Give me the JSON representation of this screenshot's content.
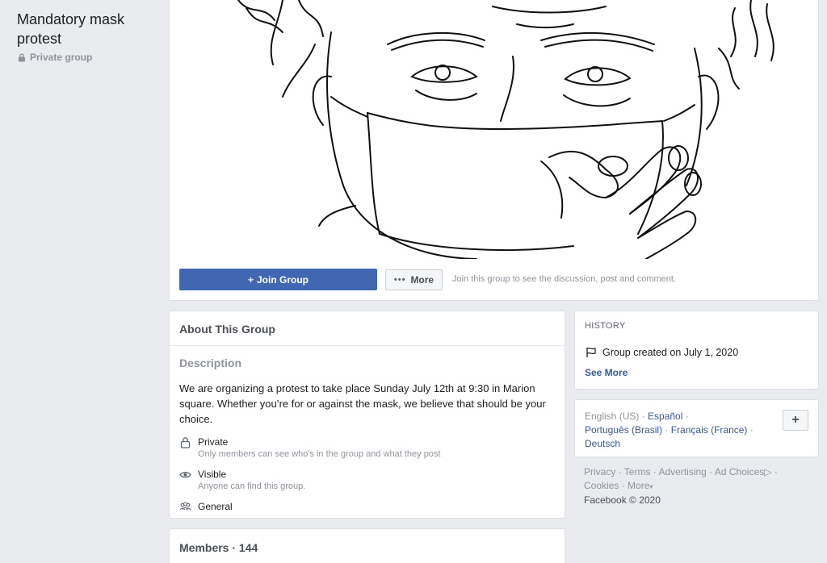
{
  "group": {
    "name": "Mandatory mask protest",
    "privacy": "Private group"
  },
  "actions": {
    "join_label": "Join Group",
    "more_label": "More",
    "hint": "Join this group to see the discussion, post and comment."
  },
  "about": {
    "title": "About This Group",
    "description_label": "Description",
    "description": "We are organizing a protest to take place Sunday July 12th at 9:30 in Marion square. Whether you’re for or against the mask, we believe that should be your choice.",
    "items": [
      {
        "title": "Private",
        "subtitle": "Only members can see who's in the group and what they post",
        "icon": "lock-icon"
      },
      {
        "title": "Visible",
        "subtitle": "Anyone can find this group.",
        "icon": "eye-icon"
      },
      {
        "title": "General",
        "subtitle": "",
        "icon": "people-icon"
      }
    ]
  },
  "members": {
    "title": "Members · 144"
  },
  "history": {
    "heading": "HISTORY",
    "created": "Group created on July 1, 2020",
    "see_more": "See More"
  },
  "languages": {
    "current": "English (US)",
    "links": [
      "Español",
      "Português (Brasil)",
      "Français (France)",
      "Deutsch"
    ],
    "plus": "+"
  },
  "footer": {
    "links": [
      "Privacy",
      "Terms",
      "Advertising",
      "Ad Choices",
      "Cookies",
      "More"
    ],
    "copyright": "Facebook © 2020"
  },
  "colors": {
    "brand_blue": "#4267b2",
    "link_blue": "#385898",
    "background": "#e9ebee"
  }
}
